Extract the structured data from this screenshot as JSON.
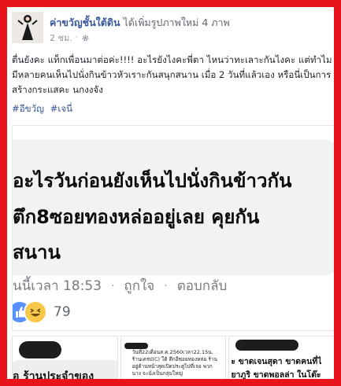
{
  "post": {
    "author": "ค่าขวัญชั้นใต้ดิน",
    "action": "ได้เพิ่มรูปภาพใหม่ 4 ภาพ",
    "time": "2 ชม.",
    "separator": "·",
    "body": "ตื่นยังคะ แท็กเพื่อนมาต่อค่ะ!!!! อะไรยังไงคะพี่ตา ไหนว่าทะเลาะกันไงคะ แต่ทำไมมีหลายคนเห็นไปนั่งกินข้าวหัวเราะกันสนุกสนาน เมื่อ 2 วันที่แล้วเอง หรือนี่เป็นการสร้างกระแสคะ นกงงจัง",
    "hashtags": [
      "#อีขวัญ",
      "#เจนี่"
    ]
  },
  "photo": {
    "line1": "อะไรวันก่อนยังเห็นไปนั่งกินข้าวกัน",
    "line2": "ตึก8ซอยทองหล่ออยู่เลย คุยกัน",
    "line3": "สนาน",
    "comment_time": "นนี้เวลา 18:53",
    "like": "ถูกใจ",
    "reply": "ตอบกลับ",
    "bullet": "·",
    "reaction_count": "79"
  },
  "thumbnails": {
    "t1_text": "อ ร้านประจำของ",
    "t2_text": "วันที่22เดือนส.ค.2560เวลา22.15น. ร้านเครป(C) ใต้ ตึกอีซอยทองหล่อ ร้าน อยู่ด้านหน้าสุดเปิดประตูไปที่เจอ พวกนาง จะนั่งเป็นกลุ่มใหญ่",
    "t3_line1": "ะ ขาดเจนสุดา ขาดคนที่ไ",
    "t3_line2": "ยาภูริ ขาดพอลล่า ในโต๊ะ"
  },
  "colors": {
    "frame": "#e8141c",
    "link": "#365899",
    "text": "#1d2129",
    "meta": "#90949c"
  },
  "icons": {
    "settings": "gear-icon",
    "like_reaction": "like-reaction-icon",
    "haha_reaction": "haha-reaction-icon"
  }
}
